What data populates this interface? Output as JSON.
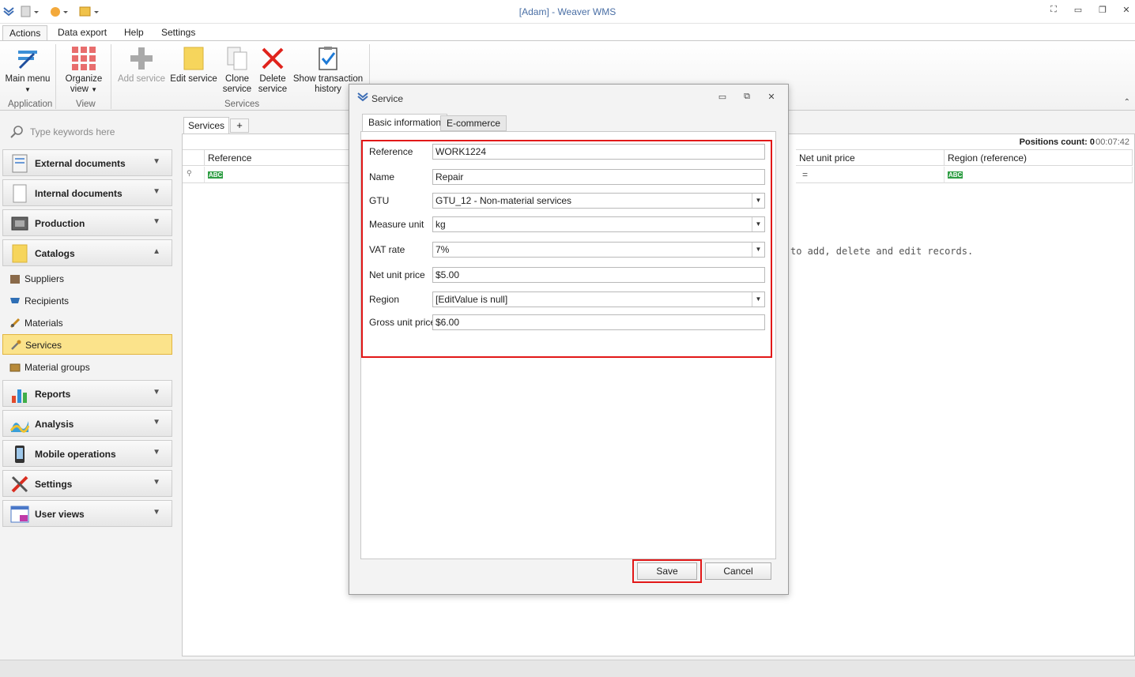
{
  "window": {
    "title": "[Adam] - Weaver WMS",
    "clock": "00:07:42"
  },
  "menu": {
    "tabs": [
      "Actions",
      "Data export",
      "Help",
      "Settings"
    ]
  },
  "ribbon": {
    "buttons": {
      "main_menu": "Main menu",
      "organize_view_1": "Organize",
      "organize_view_2": "view",
      "add_service": "Add service",
      "edit_service": "Edit service",
      "clone_service_1": "Clone",
      "clone_service_2": "service",
      "delete_service_1": "Delete",
      "delete_service_2": "service",
      "show_history_1": "Show transaction",
      "show_history_2": "history"
    },
    "groups": {
      "application": "Application",
      "view": "View",
      "services": "Services"
    }
  },
  "sidebar": {
    "search_placeholder": "Type keywords here",
    "groups": [
      {
        "label": "External documents",
        "icon": "document-icon"
      },
      {
        "label": "Internal documents",
        "icon": "page-icon"
      },
      {
        "label": "Production",
        "icon": "machine-icon"
      },
      {
        "label": "Catalogs",
        "icon": "folder-icon"
      },
      {
        "label": "Reports",
        "icon": "bar-chart-icon"
      },
      {
        "label": "Analysis",
        "icon": "analysis-icon"
      },
      {
        "label": "Mobile operations",
        "icon": "mobile-icon"
      },
      {
        "label": "Settings",
        "icon": "tools-icon"
      },
      {
        "label": "User views",
        "icon": "window-icon"
      }
    ],
    "catalog_items": [
      {
        "label": "Suppliers",
        "icon": "box-icon"
      },
      {
        "label": "Recipients",
        "icon": "cart-icon"
      },
      {
        "label": "Materials",
        "icon": "materials-icon"
      },
      {
        "label": "Services",
        "icon": "wrench-icon"
      },
      {
        "label": "Material groups",
        "icon": "group-icon"
      }
    ]
  },
  "main": {
    "tab_label": "Services",
    "add_tab": "+",
    "positions_count": "Positions count: 0",
    "columns": {
      "reference": "Reference",
      "net_unit_price": "Net unit price",
      "region_reference": "Region (reference)"
    },
    "empty_message": "to add, delete and edit records."
  },
  "dialog": {
    "title": "Service",
    "tabs": [
      "Basic information",
      "E-commerce"
    ],
    "fields": {
      "reference": {
        "label": "Reference",
        "value": "WORK1224"
      },
      "name": {
        "label": "Name",
        "value": "Repair"
      },
      "gtu": {
        "label": "GTU",
        "value": "GTU_12 - Non-material services"
      },
      "measure_unit": {
        "label": "Measure unit",
        "value": "kg"
      },
      "vat_rate": {
        "label": "VAT rate",
        "value": "7%"
      },
      "net_unit_price": {
        "label": "Net unit price",
        "value": "$5.00"
      },
      "region": {
        "label": "Region",
        "value": "[EditValue is null]"
      },
      "gross_unit_price": {
        "label": "Gross unit price",
        "value": "$6.00"
      }
    },
    "save_label": "Save",
    "cancel_label": "Cancel"
  },
  "colors": {
    "highlight": "#e21818",
    "selected_nav": "#fbe38b",
    "title_text": "#4a6fa5"
  }
}
